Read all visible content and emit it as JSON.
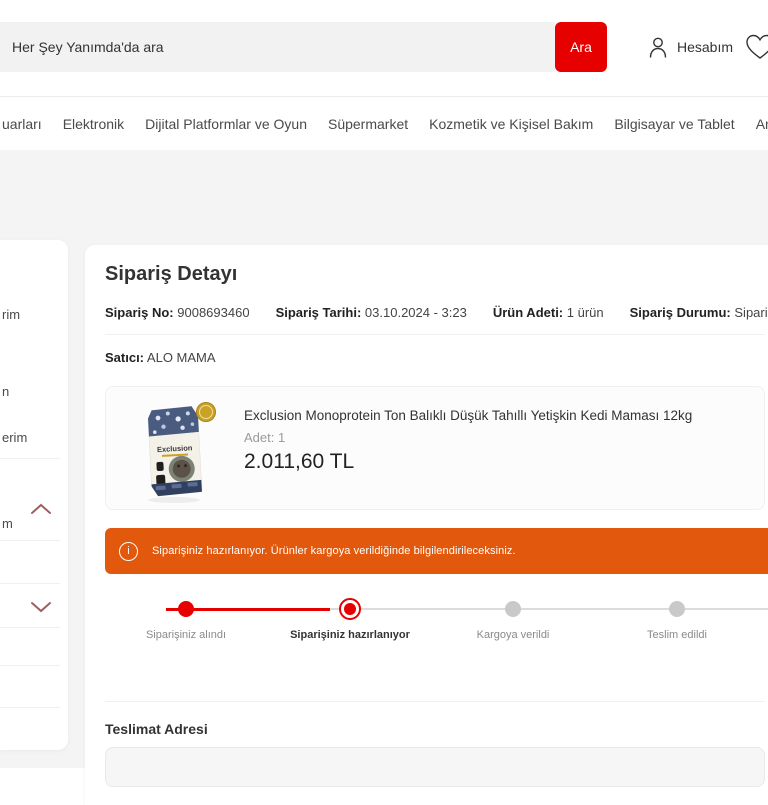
{
  "header": {
    "search": {
      "placeholder": "Her Şey Yanımda'da ara",
      "button_label": "Ara"
    },
    "account": {
      "label": "Hesabım"
    },
    "icons": {
      "user": "user-outline",
      "wishlist": "heart-outline"
    }
  },
  "nav": {
    "items": [
      {
        "label": "uarları"
      },
      {
        "label": "Elektronik"
      },
      {
        "label": "Dijital Platformlar ve Oyun"
      },
      {
        "label": "Süpermarket"
      },
      {
        "label": "Kozmetik ve Kişisel Bakım"
      },
      {
        "label": "Bilgisayar ve Tablet"
      },
      {
        "label": "Anne Beb"
      }
    ]
  },
  "sidebar": {
    "collapse_icon_top": "chevron-up",
    "collapse_icon_bottom": "chevron-down",
    "item_fragments": [
      "rim",
      "n",
      "erim",
      "m"
    ]
  },
  "order": {
    "title": "Sipariş Detayı",
    "meta": [
      {
        "label": "Sipariş No:",
        "value": "9008693460"
      },
      {
        "label": "Sipariş Tarihi:",
        "value": "03.10.2024 - 3:23"
      },
      {
        "label": "Ürün Adeti:",
        "value": "1 ürün"
      },
      {
        "label": "Sipariş Durumu:",
        "value": "Siparişiniz hazırlanıyor"
      }
    ],
    "seller": {
      "label": "Satıcı:",
      "value": "ALO MAMA"
    },
    "product": {
      "brand": "Exclusion",
      "title": "Exclusion Monoprotein Ton Balıklı Düşük Tahıllı Yetişkin Kedi Maması 12kg",
      "quantity": "Adet: 1",
      "price": "2.011,60 TL"
    },
    "alert": {
      "icon": "i",
      "text": "Siparişiniz hazırlanıyor. Ürünler kargoya verildiğinde bilgilendirileceksiniz."
    },
    "progress": {
      "steps": [
        {
          "label": "Siparişiniz alındı",
          "state": "done"
        },
        {
          "label": "Siparişiniz hazırlanıyor",
          "state": "current"
        },
        {
          "label": "Kargoya verildi",
          "state": "pending"
        },
        {
          "label": "Teslim edildi",
          "state": "pending"
        }
      ]
    },
    "delivery_section_title": "Teslimat Adresi"
  },
  "colors": {
    "brand_red": "#E60000",
    "alert_orange": "#E2590D",
    "pending_gray": "#C9C9C9",
    "sidebar_chevron": "#9E5F5F",
    "page_background": "#F4F4F4"
  }
}
